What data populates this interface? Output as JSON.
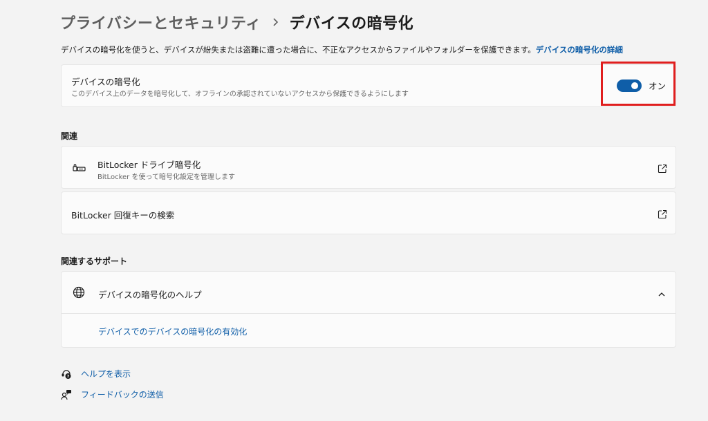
{
  "breadcrumb": {
    "parent": "プライバシーとセキュリティ",
    "current": "デバイスの暗号化"
  },
  "description": {
    "text": "デバイスの暗号化を使うと、デバイスが紛失または盗難に遭った場合に、不正なアクセスからファイルやフォルダーを保護できます。",
    "link": "デバイスの暗号化の詳細"
  },
  "encryption_card": {
    "title": "デバイスの暗号化",
    "subtitle": "このデバイス上のデータを暗号化して、オフラインの承認されていないアクセスから保護できるようにします",
    "toggle_state": "オン",
    "toggle_on": true
  },
  "related": {
    "header": "関連",
    "items": [
      {
        "title": "BitLocker ドライブ暗号化",
        "subtitle": "BitLocker を使って暗号化設定を管理します",
        "icon": "bitlocker-key-icon"
      },
      {
        "title": "BitLocker 回復キーの検索",
        "icon": "external-link-icon"
      }
    ]
  },
  "support": {
    "header": "関連するサポート",
    "help_title": "デバイスの暗号化のヘルプ",
    "help_link": "デバイスでのデバイスの暗号化の有効化",
    "expanded": true
  },
  "footer": {
    "get_help": "ヘルプを表示",
    "feedback": "フィードバックの送信"
  },
  "colors": {
    "accent": "#0f5ea8",
    "highlight": "#e01e1e",
    "background": "#f3f3f3",
    "card": "#fbfbfb"
  }
}
